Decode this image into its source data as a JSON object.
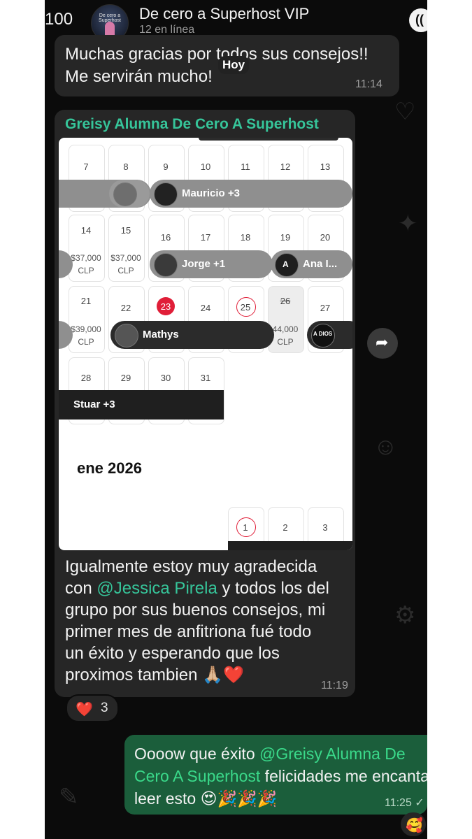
{
  "header": {
    "back_count": "100",
    "title": "De cero a Superhost VIP",
    "subtitle": "12 en línea",
    "avatar_text": "De cero a Superhost"
  },
  "date_chip": "Hoy",
  "messages": [
    {
      "text_line1": "Muchas gracias por todos sus consejos!!",
      "text_line2": "Me servirán mucho!",
      "time": "11:14"
    },
    {
      "sender": "Greisy Alumna De Cero A Superhost",
      "line1_pre": "Igualmente estoy muy agradecida",
      "line2_pre": "con ",
      "mention": "@Jessica Pirela",
      "line2_post": " y todos los del",
      "line3": "grupo por sus buenos consejos, mi",
      "line4": "primer mes de anfitriona fué todo",
      "line5": "un éxito y esperando que los",
      "line6": "proximos tambien 🙏🏼❤️",
      "time": "11:19",
      "reaction_emoji": "❤️",
      "reaction_count": "3"
    },
    {
      "pre": "Oooow que éxito ",
      "mention": "@Greisy Alumna De Cero A Superhost",
      "post": "  felicidades me encanta leer esto 😍🎉🎉🎉",
      "time": "11:25 ✓",
      "reaction_emoji": "🥰"
    }
  ],
  "calendar": {
    "row1": [
      "7",
      "8",
      "9",
      "10",
      "11",
      "12",
      "13"
    ],
    "row2": [
      "14",
      "15",
      "16",
      "17",
      "18",
      "19",
      "20"
    ],
    "row3": [
      "21",
      "22",
      "23",
      "24",
      "25",
      "26",
      "27"
    ],
    "row4": [
      "28",
      "29",
      "30",
      "31"
    ],
    "next_row": [
      "1",
      "2",
      "3"
    ],
    "price_37_a": "$37,000",
    "price_37_b": "$37,000",
    "clp": "CLP",
    "price_39": "$39,000",
    "price_44": "44,000",
    "res_mauricio": "Mauricio +3",
    "res_jorge": "Jorge +1",
    "res_ana": "Ana I...",
    "res_ana_initial": "A",
    "res_mathys": "Mathys",
    "res_stuar": "Stuar +3",
    "month": "ene 2026",
    "sticker_text": "A DIOS"
  },
  "colors": {
    "background": "#0b0b0b",
    "incoming_bubble": "#262626",
    "outgoing_bubble": "#1b5e3b",
    "accent_green": "#36c59a",
    "today_red": "#e01e38"
  },
  "icons": {
    "call": "waveform-call-icon",
    "forward": "forward-arrow-icon"
  }
}
